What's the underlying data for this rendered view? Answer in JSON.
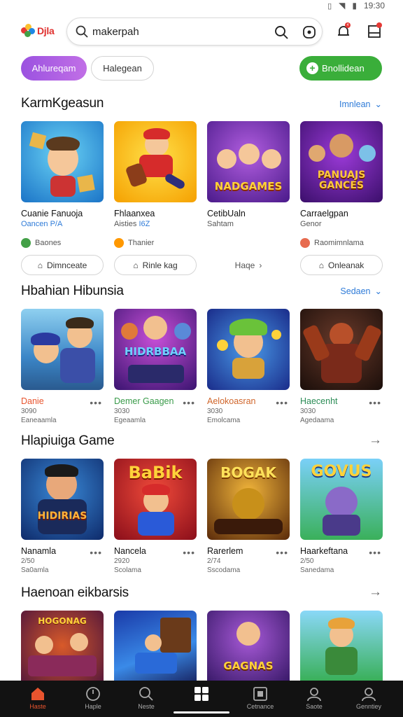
{
  "status_bar": {
    "time": "19:30"
  },
  "header": {
    "logo_text": "Djla",
    "search": {
      "value": "makerpah",
      "placeholder": "makerpah"
    },
    "notif_count": "4"
  },
  "chips": {
    "primary": "Ahlureqam",
    "secondary": "Halegean",
    "action": "Bnollidean"
  },
  "sections": [
    {
      "title": "KarmKgeasun",
      "link": "Imnlean",
      "games": [
        {
          "name": "Cuanie Fanuoja",
          "sub": "Oancen",
          "sub_hi": "P/A",
          "badge": "Baones",
          "badge_color": "#43a047",
          "pill": "Dimnceate"
        },
        {
          "name": "Fhlaanxea",
          "sub": "Aisties",
          "sub_hi": "I6Z",
          "badge": "Thanier",
          "badge_color": "#ff9800",
          "pill": "Rinle kag"
        },
        {
          "name": "CetibUaln",
          "sub": "Sahtam",
          "sub_hi": "",
          "badge": "",
          "badge_color": "",
          "pill": "Haqe"
        },
        {
          "name": "Carraelgpan",
          "sub": "Genor",
          "sub_hi": "",
          "badge": "Raomimnlama",
          "badge_color": "#e76b4f",
          "pill": "Onleanak"
        }
      ]
    },
    {
      "title": "Hbahian Hibunsia",
      "link": "Sedaen",
      "games": [
        {
          "name": "Danie",
          "rating": "3090",
          "genre": "Eaneaamla",
          "accent": "#e8542e"
        },
        {
          "name": "Demer Gaagen",
          "rating": "3030",
          "genre": "Egeaamla",
          "accent": "#3a9b4a"
        },
        {
          "name": "Aelokoasran",
          "rating": "3030",
          "genre": "Emolcama",
          "accent": "#d0652a"
        },
        {
          "name": "Haecenht",
          "rating": "3030",
          "genre": "Agedaama",
          "accent": "#2b8c56"
        }
      ]
    },
    {
      "title": "Hlapiuiga Game",
      "games": [
        {
          "name": "Nanamla",
          "rating": "2/50",
          "genre": "Sa0amla"
        },
        {
          "name": "Nancela",
          "rating": "2920",
          "genre": "Scolama"
        },
        {
          "name": "Rarerlem",
          "rating": "2/74",
          "genre": "Sscodama"
        },
        {
          "name": "Haarkeftana",
          "rating": "2/50",
          "genre": "Sanedama"
        }
      ]
    },
    {
      "title": "Haenoan eikbarsis"
    }
  ],
  "thumb_texts": [
    "",
    "",
    "NADGAMES",
    "PANUAJS GANCES",
    "",
    "HIDRBBAA",
    "",
    "",
    "HIDIRIAS",
    "BaBik",
    "BOGAK",
    "GOVUS",
    "HOGONAG",
    "",
    "GAGNAS",
    ""
  ],
  "bottom_nav": [
    {
      "label": "Haste",
      "icon": "home-icon",
      "active": true
    },
    {
      "label": "Haple",
      "icon": "clock-icon",
      "active": false
    },
    {
      "label": "Neste",
      "icon": "search-icon",
      "active": false
    },
    {
      "label": "",
      "icon": "grid-icon",
      "active": false
    },
    {
      "label": "Cetnance",
      "icon": "box-icon",
      "active": false
    },
    {
      "label": "Saote",
      "icon": "person-icon",
      "active": false
    },
    {
      "label": "Genntiey",
      "icon": "profile-icon",
      "active": false
    }
  ]
}
